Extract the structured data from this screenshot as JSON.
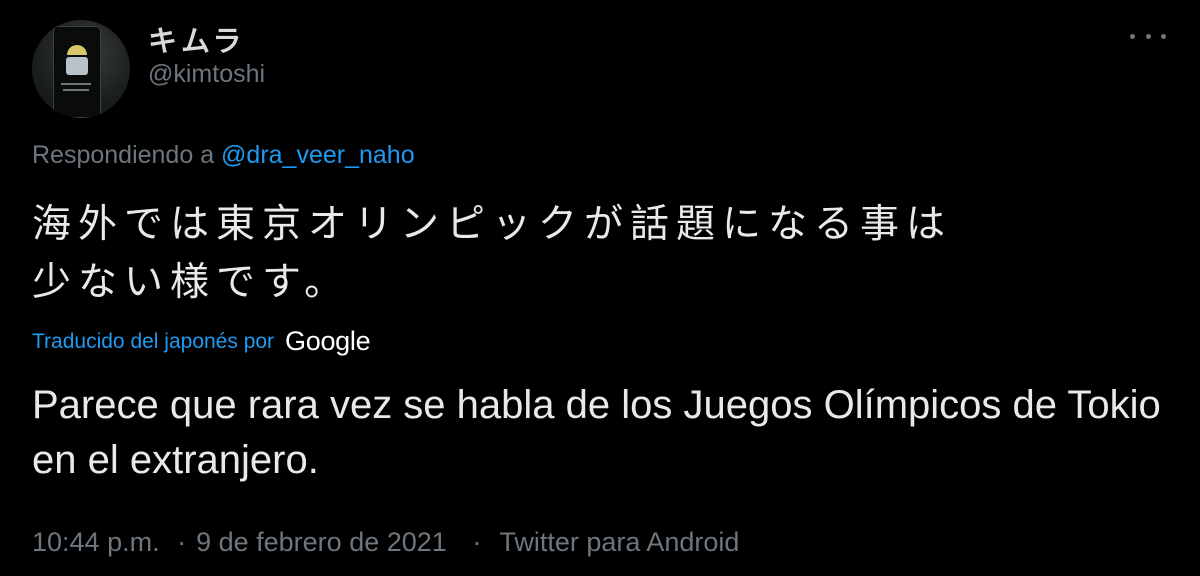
{
  "author": {
    "display_name": "キムラ",
    "handle": "@kimtoshi"
  },
  "reply": {
    "prefix": "Respondiendo a",
    "mention": "@dra_veer_naho"
  },
  "tweet": {
    "original_line1": "海外では東京オリンピックが話題になる事は",
    "original_line2": "少ない様です。",
    "translated_by": "Traducido del japonés por",
    "translator": "Google",
    "translation": "Parece que rara vez se habla de los Juegos Olímpicos de Tokio en el extranjero."
  },
  "meta": {
    "time": "10:44 p.m.",
    "separator": "·",
    "date": "9 de febrero de 2021",
    "source": "Twitter para Android"
  },
  "colors": {
    "background": "#000000",
    "text": "#e7e9ea",
    "muted": "#6e767d",
    "link": "#1d9bf0"
  },
  "icons": {
    "more": "more-horizontal-icon",
    "avatar": "avatar-image"
  }
}
